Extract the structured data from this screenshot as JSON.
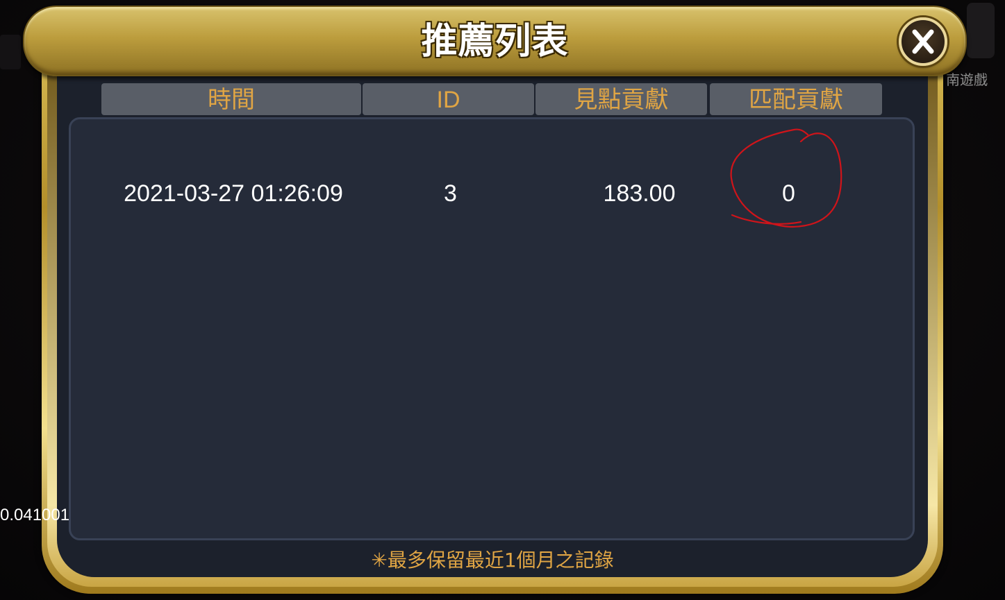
{
  "dialog": {
    "title": "推薦列表",
    "close_label": "X"
  },
  "table": {
    "columns": [
      "時間",
      "ID",
      "見點貢獻",
      "匹配貢獻"
    ],
    "rows": [
      {
        "time": "2021-03-27 01:26:09",
        "id": "3",
        "points": "183.00",
        "match": "0"
      }
    ]
  },
  "footer": {
    "note": "✳最多保留最近1個月之記錄"
  },
  "background": {
    "number_text": "0.041001",
    "right_fragment": "南遊戲"
  },
  "colors": {
    "header_gold": "#bc9d3d",
    "column_text": "#e0a544",
    "panel_bg": "#252b39",
    "annotation": "#d0141a"
  }
}
